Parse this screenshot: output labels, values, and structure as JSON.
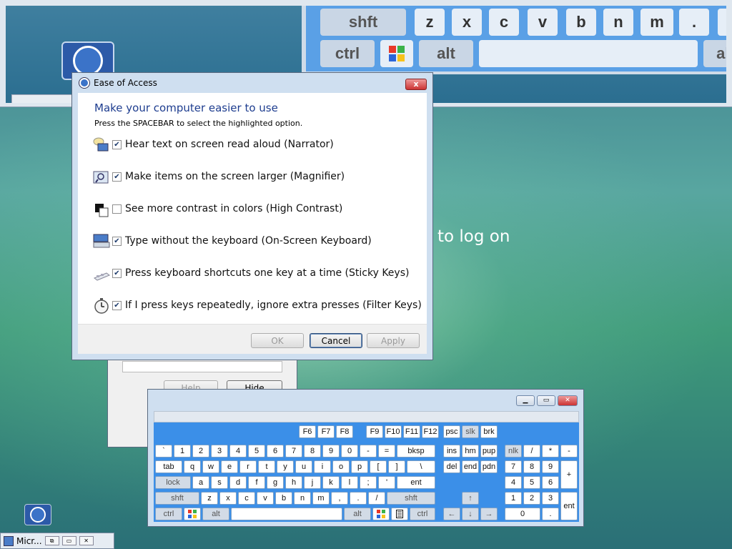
{
  "desktop": {
    "logon_text": "to log on"
  },
  "magnifier": {
    "keys_row1": [
      "shft",
      "z",
      "x",
      "c",
      "v",
      "b",
      "n",
      "m",
      ".",
      ""
    ],
    "keys_row2": [
      "ctrl",
      "",
      "alt",
      "",
      "alt"
    ]
  },
  "ease_dialog": {
    "title": "Ease of Access",
    "heading": "Make your computer easier to use",
    "instruction": "Press the SPACEBAR to select the highlighted option.",
    "options": [
      {
        "label": "Hear text on screen read aloud (Narrator)",
        "checked": true,
        "icon": "narrator-icon"
      },
      {
        "label": "Make items on the screen larger (Magnifier)",
        "checked": true,
        "icon": "magnifier-icon"
      },
      {
        "label": "See more contrast in colors (High Contrast)",
        "checked": false,
        "icon": "high-contrast-icon"
      },
      {
        "label": "Type without the keyboard (On-Screen Keyboard)",
        "checked": true,
        "icon": "keyboard-icon"
      },
      {
        "label": "Press keyboard shortcuts one key at a time (Sticky Keys)",
        "checked": true,
        "icon": "sticky-keys-icon"
      },
      {
        "label": "If I press keys repeatedly, ignore extra presses (Filter Keys)",
        "checked": true,
        "icon": "filter-keys-icon"
      }
    ],
    "ok_label": "OK",
    "cancel_label": "Cancel",
    "apply_label": "Apply",
    "close_label": "x"
  },
  "background_dialog": {
    "help_label": "Help",
    "hide_label": "Hide"
  },
  "osk": {
    "fn_row": [
      "F6",
      "F7",
      "F8",
      "F9",
      "F10",
      "F11",
      "F12",
      "psc",
      "slk",
      "brk"
    ],
    "num_row": [
      "`",
      "1",
      "2",
      "3",
      "4",
      "5",
      "6",
      "7",
      "8",
      "9",
      "0",
      "-",
      "=",
      "bksp",
      "ins",
      "hm",
      "pup",
      "nlk",
      "/",
      "*",
      "-"
    ],
    "tab_row": [
      "tab",
      "q",
      "w",
      "e",
      "r",
      "t",
      "y",
      "u",
      "i",
      "o",
      "p",
      "[",
      "]",
      "\\",
      "del",
      "end",
      "pdn",
      "7",
      "8",
      "9",
      "+"
    ],
    "caps_row": [
      "lock",
      "a",
      "s",
      "d",
      "f",
      "g",
      "h",
      "j",
      "k",
      "l",
      ";",
      "'",
      "ent",
      "4",
      "5",
      "6"
    ],
    "shift_row": [
      "shft",
      "z",
      "x",
      "c",
      "v",
      "b",
      "n",
      "m",
      ",",
      ".",
      "/",
      "shft",
      "↑",
      "1",
      "2",
      "3",
      "ent"
    ],
    "bottom_row": [
      "ctrl",
      "",
      "alt",
      "",
      "alt",
      "",
      "",
      "ctrl",
      "←",
      "↓",
      "→",
      "0",
      "."
    ]
  },
  "taskbar": {
    "label": "Micr..."
  }
}
